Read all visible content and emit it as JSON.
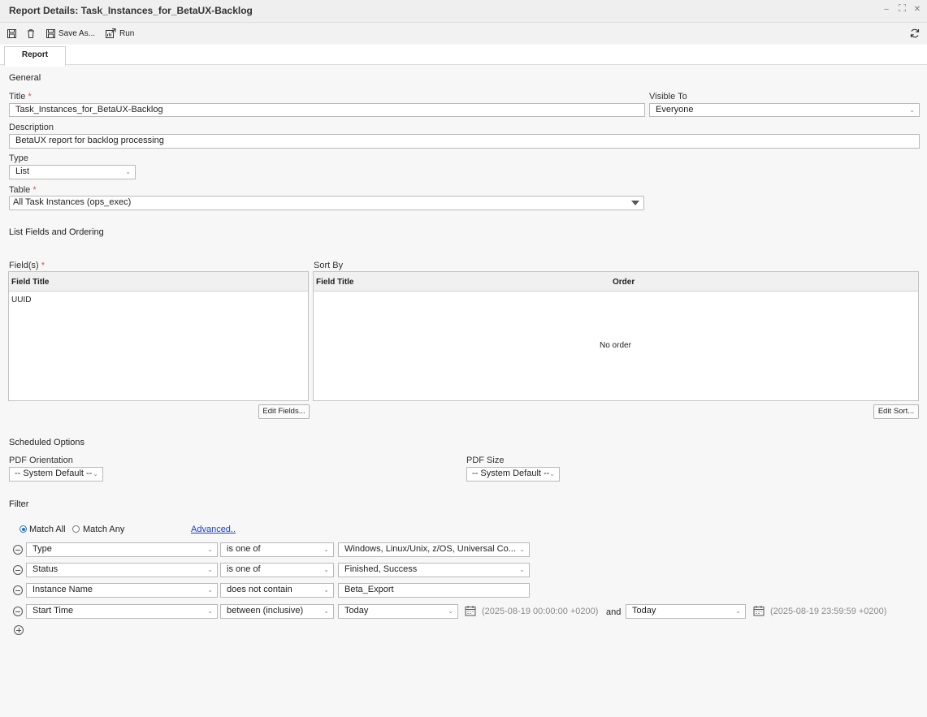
{
  "window": {
    "title": "Report Details: Task_Instances_for_BetaUX-Backlog"
  },
  "toolbar": {
    "save_as": "Save As...",
    "run": "Run"
  },
  "tabs": [
    {
      "label": "Report"
    }
  ],
  "general": {
    "heading": "General",
    "title_label": "Title",
    "title_value": "Task_Instances_for_BetaUX-Backlog",
    "visible_to_label": "Visible To",
    "visible_to_value": "Everyone",
    "description_label": "Description",
    "description_value": "BetaUX report for backlog processing",
    "type_label": "Type",
    "type_value": "List",
    "table_label": "Table",
    "table_value": "All Task Instances (ops_exec)",
    "required_mark": "*"
  },
  "list_fields": {
    "heading": "List Fields and Ordering",
    "fields_label": "Field(s)",
    "fields_col": "Field Title",
    "fields": [
      "UUID"
    ],
    "sort_label": "Sort By",
    "sort_col_title": "Field Title",
    "sort_col_order": "Order",
    "sort_empty": "No order",
    "edit_fields": "Edit Fields...",
    "edit_sort": "Edit Sort..."
  },
  "scheduled": {
    "heading": "Scheduled Options",
    "orientation_label": "PDF Orientation",
    "orientation_value": "-- System Default --",
    "size_label": "PDF Size",
    "size_value": "-- System Default --"
  },
  "filter": {
    "heading": "Filter",
    "match_all": "Match All",
    "match_any": "Match Any",
    "advanced": "Advanced..",
    "rows": [
      {
        "field": "Type",
        "op": "is one of",
        "value": "Windows, Linux/Unix, z/OS, Universal Co..."
      },
      {
        "field": "Status",
        "op": "is one of",
        "value": "Finished, Success"
      },
      {
        "field": "Instance Name",
        "op": "does not contain",
        "value": "Beta_Export"
      },
      {
        "field": "Start Time",
        "op": "between (inclusive)",
        "value": "Today",
        "value_ts": "(2025-08-19 00:00:00 +0200)",
        "and": "and",
        "value2": "Today",
        "value2_ts": "(2025-08-19 23:59:59 +0200)"
      }
    ]
  }
}
